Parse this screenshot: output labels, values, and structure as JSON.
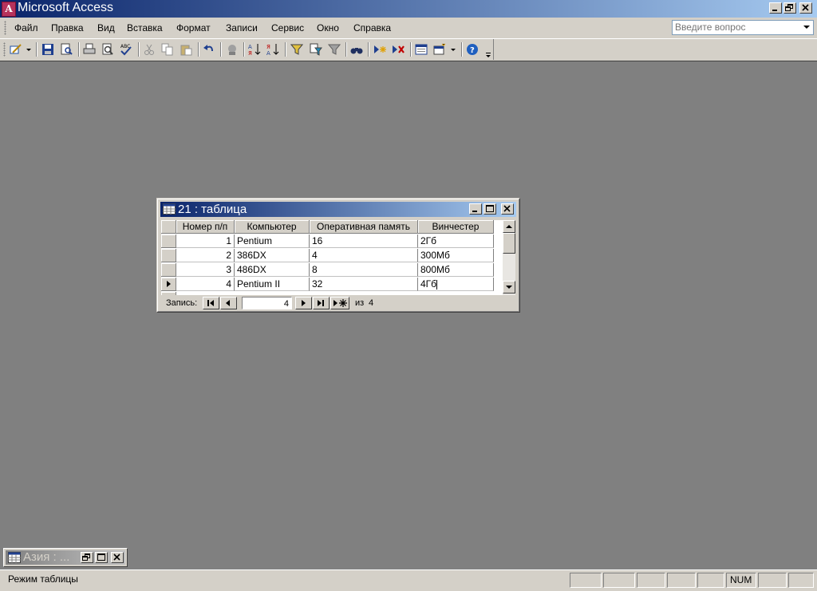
{
  "app": {
    "title": "Microsoft Access",
    "icon_letter": "A"
  },
  "menu": {
    "items": [
      "Файл",
      "Правка",
      "Вид",
      "Вставка",
      "Формат",
      "Записи",
      "Сервис",
      "Окно",
      "Справка"
    ],
    "ask_placeholder": "Введите вопрос"
  },
  "table_window": {
    "title": "21 : таблица",
    "columns": [
      "Номер п/п",
      "Компьютер",
      "Оперативная память",
      "Винчестер"
    ],
    "rows": [
      [
        "1",
        "Pentium",
        "16",
        "2Гб"
      ],
      [
        "2",
        "386DX",
        "4",
        "300Мб"
      ],
      [
        "3",
        "486DX",
        "8",
        "800Мб"
      ],
      [
        "4",
        "Pentium II",
        "32",
        "4Гб"
      ]
    ],
    "nav": {
      "record_label": "Запись:",
      "current_record": "4",
      "of_label": "из",
      "total": "4"
    }
  },
  "minimized_window": {
    "title": "Азия : ..."
  },
  "status": {
    "mode": "Режим таблицы",
    "num": "NUM"
  },
  "colors": {
    "title_gradient_start": "#0a246a",
    "title_gradient_end": "#a6caf0",
    "workspace": "#808080",
    "chrome": "#d4d0c8"
  }
}
